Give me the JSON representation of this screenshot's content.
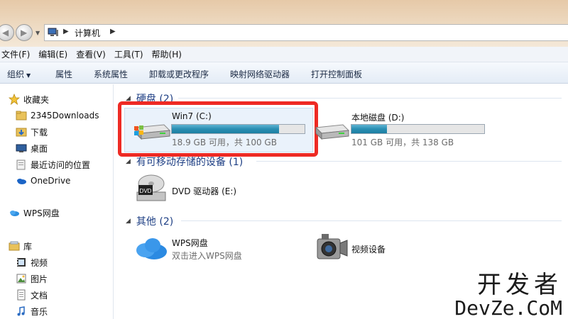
{
  "address": {
    "location": "计算机"
  },
  "menu": [
    "文件(F)",
    "编辑(E)",
    "查看(V)",
    "工具(T)",
    "帮助(H)"
  ],
  "toolbar": {
    "organize": "组织",
    "properties": "属性",
    "system_properties": "系统属性",
    "uninstall": "卸载或更改程序",
    "map_drive": "映射网络驱动器",
    "control_panel": "打开控制面板"
  },
  "nav": {
    "favorites": "收藏夹",
    "downloads_2345": "2345Downloads",
    "downloads": "下载",
    "desktop": "桌面",
    "recent": "最近访问的位置",
    "onedrive": "OneDrive",
    "wps": "WPS网盘",
    "library": "库",
    "videos": "视频",
    "pictures": "图片",
    "documents": "文档",
    "music": "音乐"
  },
  "groups": {
    "hdd": "硬盘 (2)",
    "removable": "有可移动存储的设备 (1)",
    "other": "其他 (2)"
  },
  "drives": [
    {
      "name": "Win7 (C:)",
      "size": "18.9 GB 可用，共 100 GB",
      "used_fraction": 0.81
    },
    {
      "name": "本地磁盘 (D:)",
      "size": "101 GB 可用，共 138 GB",
      "used_fraction": 0.27
    }
  ],
  "dvd": {
    "name": "DVD 驱动器 (E:)",
    "badge": "DVD"
  },
  "other_items": {
    "wps_name": "WPS网盘",
    "wps_desc": "双击进入WPS网盘",
    "video_device": "视频设备"
  },
  "watermark": {
    "line1": "开发者",
    "line2": "DevZe.CoM"
  },
  "colors": {
    "accent": "#2a8fb3",
    "highlight": "#ee2a24",
    "group_header": "#1e3f84"
  }
}
